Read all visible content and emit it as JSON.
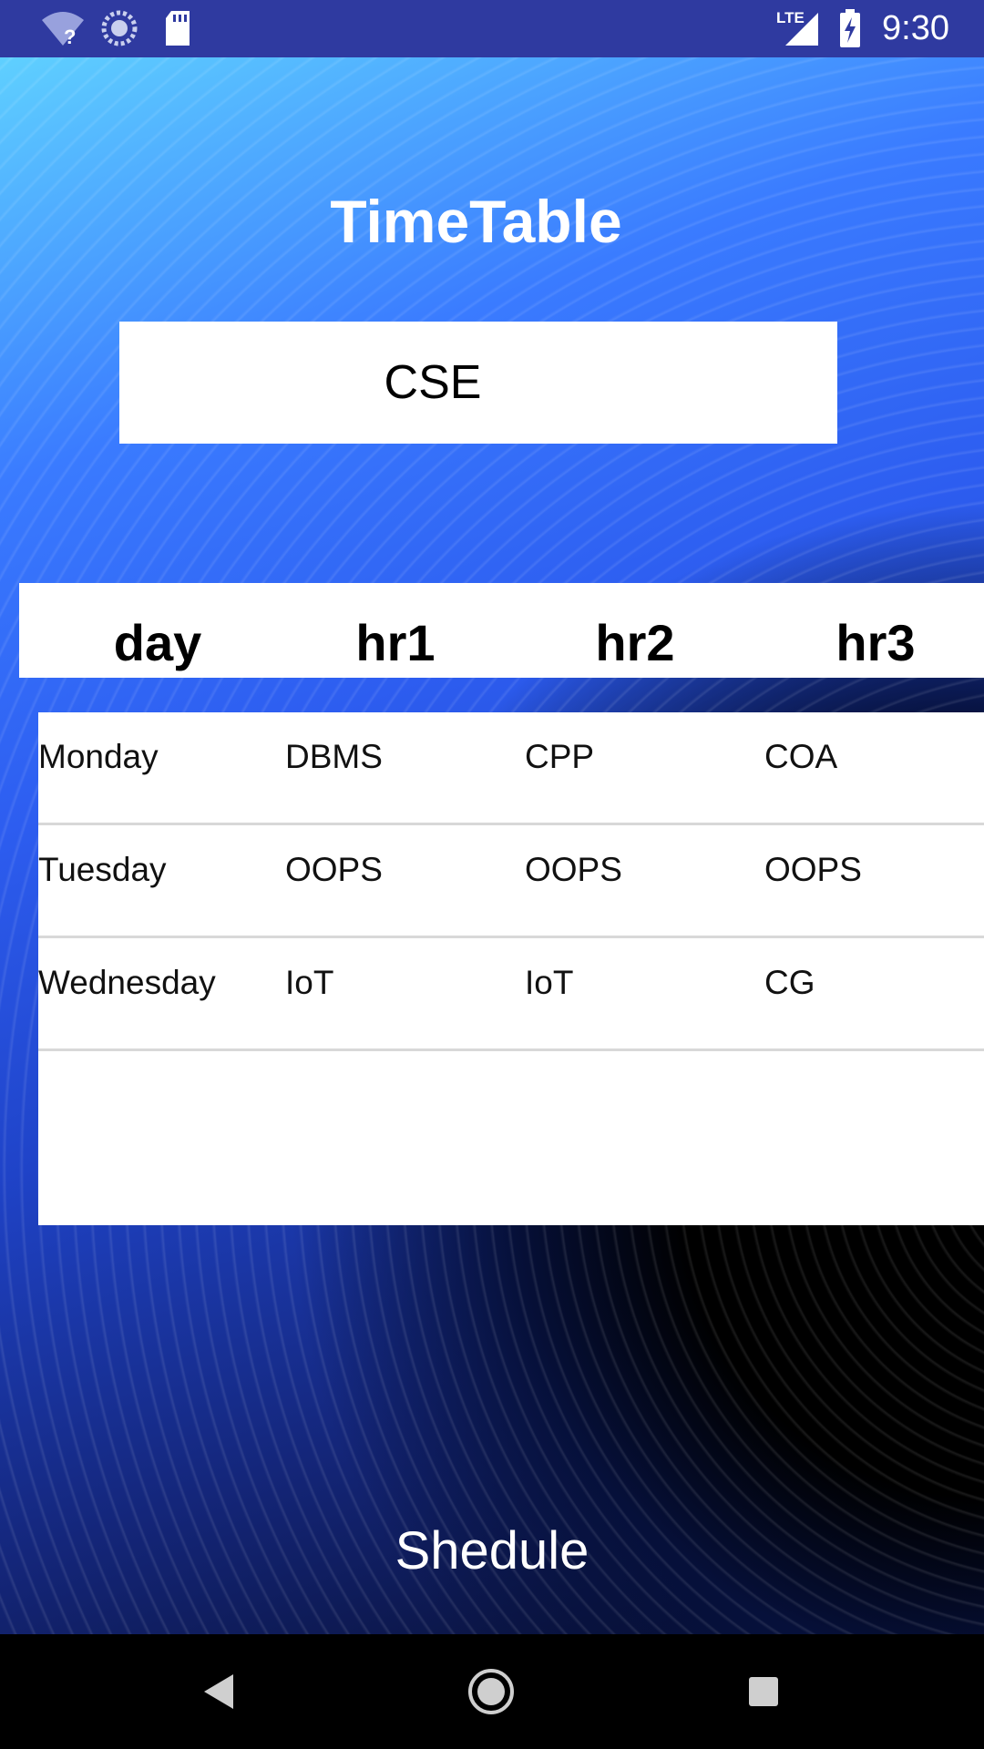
{
  "status_bar": {
    "time": "9:30",
    "network_label": "LTE",
    "icons": [
      "wifi-unknown-icon",
      "sync-icon",
      "sd-card-icon",
      "signal-icon",
      "battery-charging-icon"
    ]
  },
  "app": {
    "title": "TimeTable",
    "department": "CSE",
    "schedule_button": "Shedule"
  },
  "table": {
    "headers": [
      "day",
      "hr1",
      "hr2",
      "hr3"
    ],
    "rows": [
      [
        "Monday",
        "DBMS",
        "CPP",
        "COA"
      ],
      [
        "Tuesday",
        "OOPS",
        "OOPS",
        "OOPS"
      ],
      [
        "Wednesday",
        "IoT",
        "IoT",
        "CG"
      ]
    ]
  },
  "nav_bar": {
    "icons": [
      "back-icon",
      "home-icon",
      "recents-icon"
    ]
  }
}
